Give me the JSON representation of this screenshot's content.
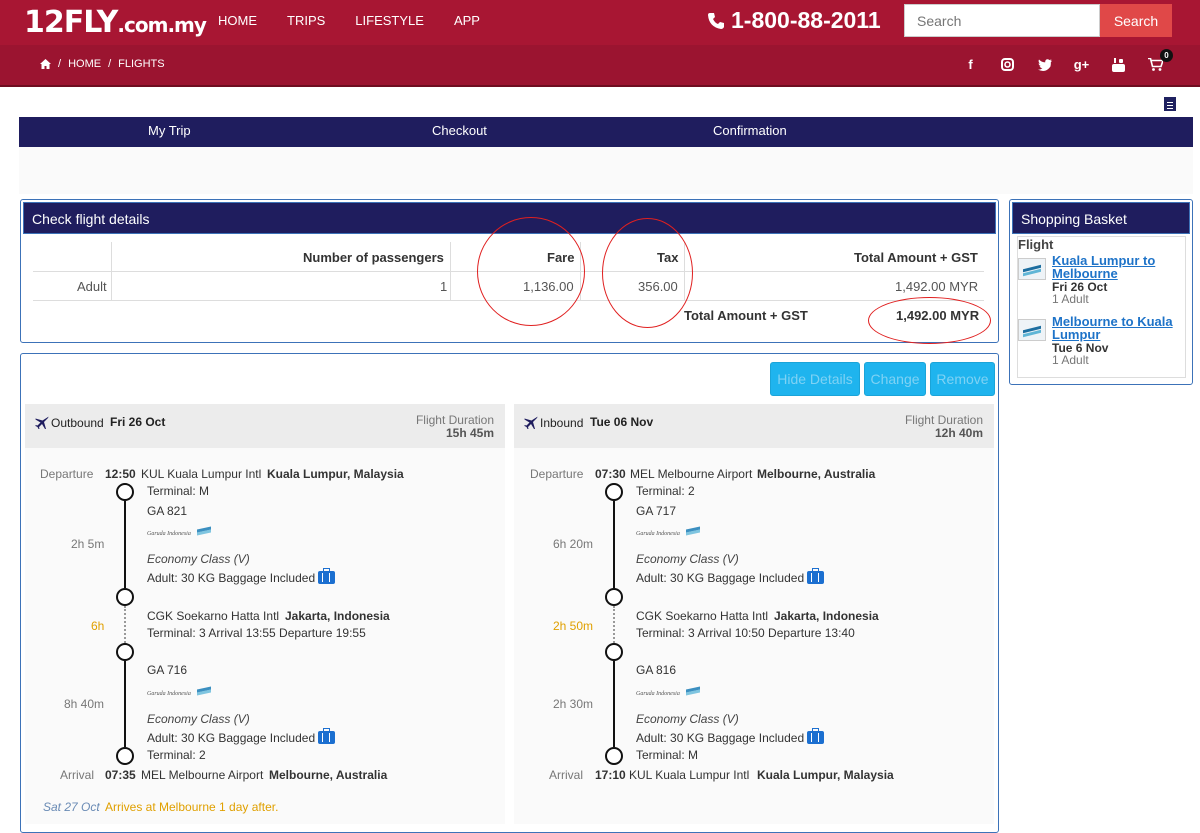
{
  "header": {
    "logo": "12FLY",
    "logo_domain": ".com.my",
    "nav": [
      "HOME",
      "TRIPS",
      "LIFESTYLE",
      "APP"
    ],
    "phone": "1-800-88-2011",
    "search_placeholder": "Search",
    "search_button": "Search"
  },
  "breadcrumb": [
    "HOME",
    "FLIGHTS"
  ],
  "social_icons": [
    "facebook-icon",
    "instagram-icon",
    "twitter-icon",
    "google-plus-icon",
    "youtube-icon",
    "cart-icon"
  ],
  "cart_count": "0",
  "steps": [
    "My Trip",
    "Checkout",
    "Confirmation"
  ],
  "check": {
    "title": "Check flight details",
    "headers": [
      "Number of passengers",
      "Fare",
      "Tax",
      "Total Amount + GST"
    ],
    "row": {
      "type": "Adult",
      "count": "1",
      "fare": "1,136.00",
      "tax": "356.00",
      "total": "1,492.00 MYR"
    },
    "grand_label": "Total Amount + GST",
    "grand_total": "1,492.00 MYR"
  },
  "basket": {
    "title": "Shopping Basket",
    "section": "Flight",
    "items": [
      {
        "route": "Kuala Lumpur to Melbourne",
        "date": "Fri 26 Oct",
        "pax": "1 Adult"
      },
      {
        "route": "Melbourne to Kuala Lumpur",
        "date": "Tue 6 Nov",
        "pax": "1 Adult"
      }
    ]
  },
  "actions": [
    "Hide Details",
    "Change",
    "Remove"
  ],
  "outbound": {
    "direction": "Outbound",
    "date": "Fri 26 Oct",
    "duration_label": "Flight Duration",
    "duration": "15h 45m",
    "departure_label": "Departure",
    "dep_time": "12:50",
    "dep_airport": "KUL Kuala Lumpur Intl",
    "dep_city": "Kuala Lumpur, Malaysia",
    "dep_terminal": "Terminal: M",
    "flight1": "GA 821",
    "class1": "Economy Class (V)",
    "bag1": "Adult: 30 KG Baggage Included",
    "time1": "2h 5m",
    "layover": "6h",
    "stop_airport": "CGK Soekarno Hatta Intl",
    "stop_city": "Jakarta, Indonesia",
    "stop_info": "Terminal: 3  Arrival 13:55 Departure 19:55",
    "flight2": "GA 716",
    "class2": "Economy Class (V)",
    "bag2": "Adult: 30 KG Baggage Included",
    "time2": "8h 40m",
    "arr_terminal": "Terminal: 2",
    "arrival_label": "Arrival",
    "arr_time": "07:35",
    "arr_airport": "MEL Melbourne Airport",
    "arr_city": "Melbourne, Australia",
    "note_date": "Sat 27 Oct",
    "note": "Arrives at Melbourne 1 day after."
  },
  "inbound": {
    "direction": "Inbound",
    "date": "Tue 06 Nov",
    "duration_label": "Flight Duration",
    "duration": "12h 40m",
    "departure_label": "Departure",
    "dep_time": "07:30",
    "dep_airport": "MEL Melbourne Airport",
    "dep_city": "Melbourne, Australia",
    "dep_terminal": "Terminal: 2",
    "flight1": "GA 717",
    "class1": "Economy Class (V)",
    "bag1": "Adult: 30 KG Baggage Included",
    "time1": "6h 20m",
    "layover": "2h 50m",
    "stop_airport": "CGK Soekarno Hatta Intl",
    "stop_city": "Jakarta, Indonesia",
    "stop_info": "Terminal: 3  Arrival 10:50 Departure 13:40",
    "flight2": "GA 816",
    "class2": "Economy Class (V)",
    "bag2": "Adult: 30 KG Baggage Included",
    "time2": "2h 30m",
    "arr_terminal": "Terminal: M",
    "arrival_label": "Arrival",
    "arr_time": "17:10",
    "arr_airport": "KUL Kuala Lumpur Intl",
    "arr_city": "Kuala Lumpur, Malaysia"
  }
}
